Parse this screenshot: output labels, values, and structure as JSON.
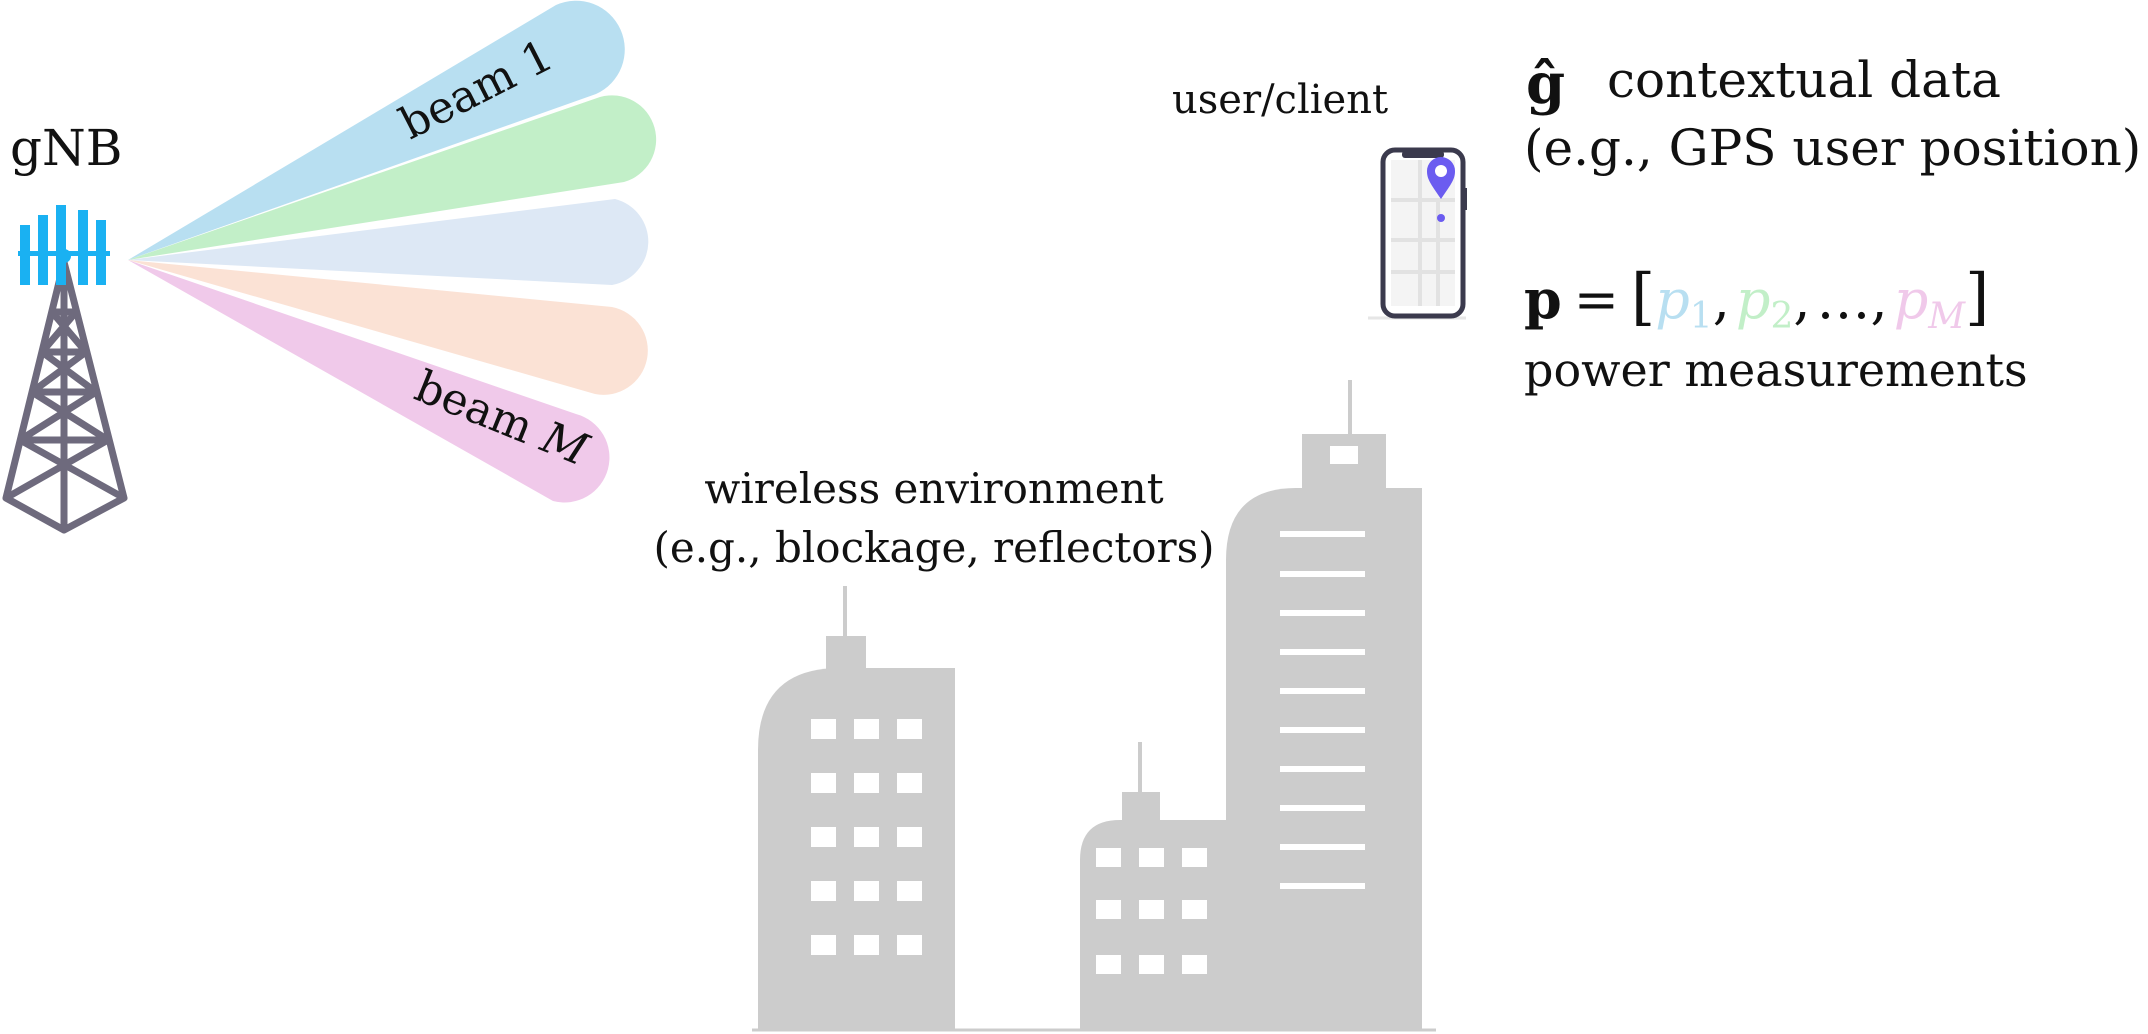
{
  "gnb": {
    "label": "gNB"
  },
  "beams": {
    "first_label": "beam 1",
    "last_label_word": "beam",
    "last_label_var": "M",
    "colors": [
      "#b8dff1",
      "#c2efc8",
      "#dde8f5",
      "#fbe2d5",
      "#f0c9ea"
    ]
  },
  "user": {
    "label": "user/client"
  },
  "context": {
    "symbol": "ĝ",
    "symbol_color": "#6b5cf0",
    "title": "contextual data",
    "subtitle": "(e.g., GPS user position)"
  },
  "power": {
    "vector_symbol": "p",
    "equals": "=",
    "open_bracket": "[",
    "close_bracket": "]",
    "terms": [
      {
        "base": "p",
        "sub": "1",
        "color": "#b8dff1"
      },
      {
        "base": "p",
        "sub": "2",
        "color": "#c2efc8"
      },
      {
        "base": "p",
        "sub": "M",
        "color": "#f0c9ea"
      }
    ],
    "ellipsis": "…",
    "comma": ",",
    "caption": "power measurements"
  },
  "environment": {
    "title": "wireless environment",
    "subtitle": "(e.g., blockage, reflectors)"
  },
  "colors": {
    "tower": "#6e6a7d",
    "antenna": "#1ab1f2",
    "building": "#cccccc",
    "phone_frame": "#3b3a4d",
    "pin": "#6b5cf0"
  }
}
